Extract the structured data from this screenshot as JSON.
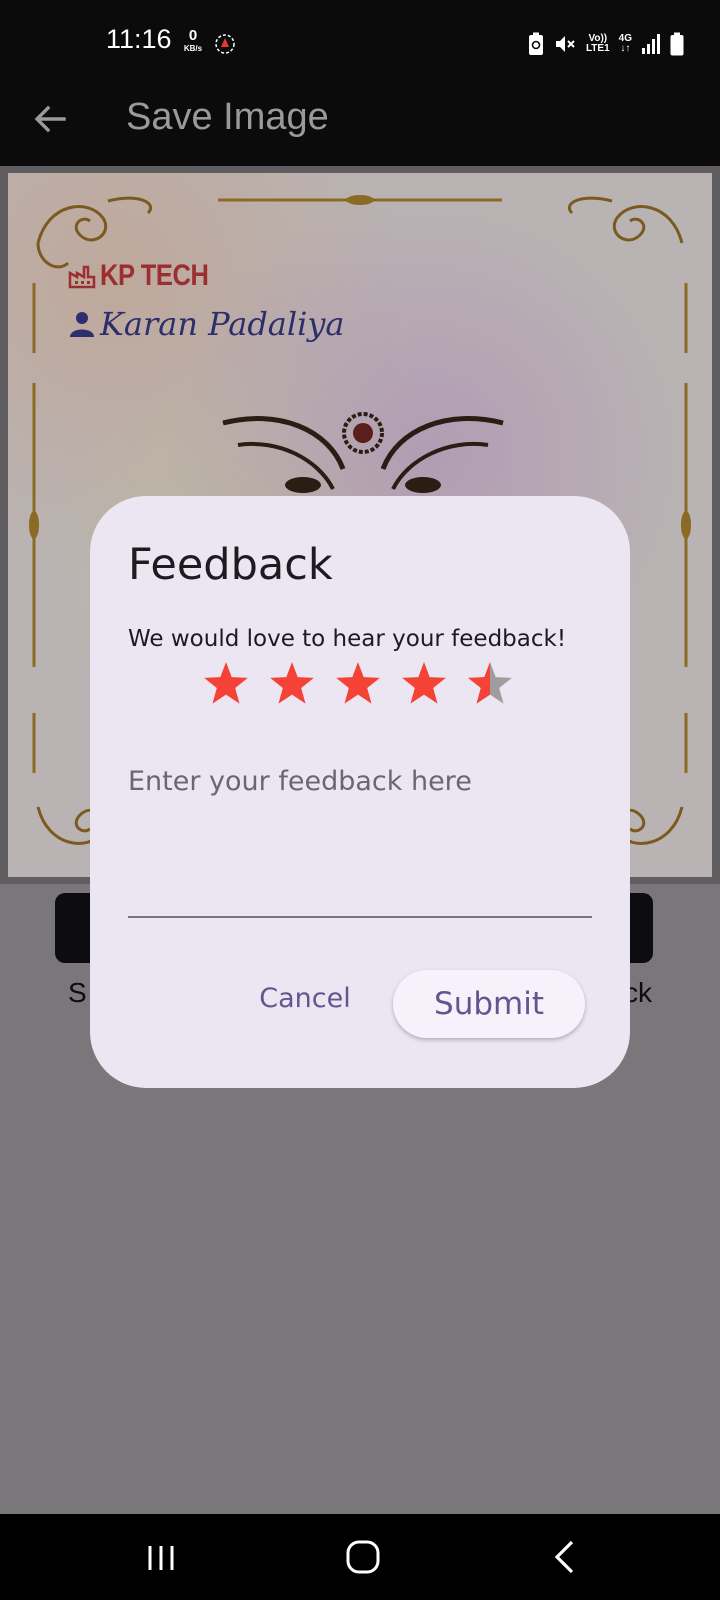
{
  "status_bar": {
    "time": "11:16",
    "net_speed_value": "0",
    "net_speed_unit": "KB/s",
    "volte_top": "Vo))",
    "volte_bottom": "LTE1",
    "network_type": "4G",
    "icons": [
      "app-notification-icon",
      "battery-saver-icon",
      "mute-icon",
      "volte-icon",
      "network-4g-icon",
      "signal-icon",
      "battery-icon"
    ]
  },
  "app_bar": {
    "title": "Save Image",
    "back_icon": "arrow-left-icon"
  },
  "card": {
    "brand": "KP TECH",
    "person_name": "Karan Padaliya",
    "brand_color": "#9a2e30",
    "person_color": "#2d2f6a"
  },
  "background_actions": {
    "left_label_fragment": "S",
    "right_label_fragment": "ck"
  },
  "dialog": {
    "title": "Feedback",
    "subtitle": "We would love to hear your feedback!",
    "rating": 4.5,
    "max_rating": 5,
    "star_color": "#f44336",
    "star_empty_color": "#9e9e9e",
    "input_placeholder": "Enter your feedback here",
    "input_value": "",
    "cancel_label": "Cancel",
    "submit_label": "Submit",
    "accent_color": "#65558f"
  },
  "nav_bar": {
    "icons": [
      "recents-icon",
      "home-icon",
      "back-icon"
    ]
  }
}
